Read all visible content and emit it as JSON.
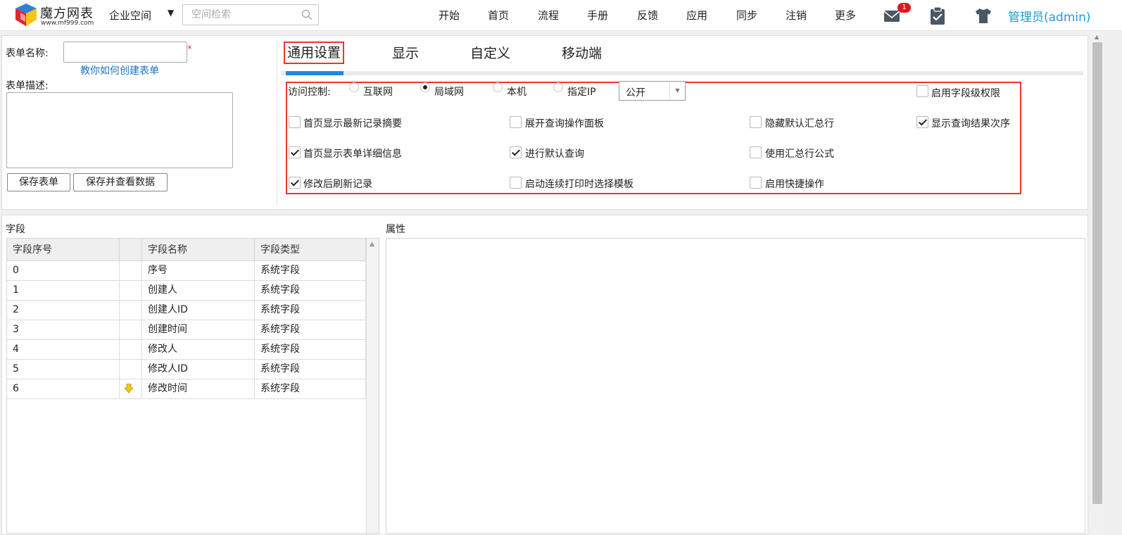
{
  "header": {
    "logo_title": "魔方网表",
    "logo_url": "www.mf999.com",
    "space_label": "企业空间",
    "search_placeholder": "空间检索",
    "nav": [
      "开始",
      "首页",
      "流程",
      "手册",
      "反馈",
      "应用",
      "同步",
      "注销",
      "更多"
    ],
    "mail_badge": "1",
    "admin": "管理员(admin)",
    "icons": [
      "mail-icon",
      "clipboard-icon",
      "tshirt-icon",
      "search-icon"
    ]
  },
  "form": {
    "name_label": "表单名称:",
    "name_value": "",
    "required_mark": "*",
    "help_link": "教你如何创建表单",
    "desc_label": "表单描述:",
    "desc_value": "",
    "save_button": "保存表单",
    "save_view_button": "保存并查看数据"
  },
  "tabs": [
    "通用设置",
    "显示",
    "自定义",
    "移动端"
  ],
  "active_tab": "通用设置",
  "settings": {
    "access_label": "访问控制:",
    "access_options": [
      "互联网",
      "局域网",
      "本机",
      "指定IP"
    ],
    "access_selected": "局域网",
    "visibility_select": "公开",
    "checkboxes": [
      {
        "label": "启用字段级权限",
        "checked": false
      },
      {
        "label": "首页显示最新记录摘要",
        "checked": false
      },
      {
        "label": "展开查询操作面板",
        "checked": false
      },
      {
        "label": "隐藏默认汇总行",
        "checked": false
      },
      {
        "label": "显示查询结果次序",
        "checked": true
      },
      {
        "label": "首页显示表单详细信息",
        "checked": true
      },
      {
        "label": "进行默认查询",
        "checked": true
      },
      {
        "label": "使用汇总行公式",
        "checked": false
      },
      {
        "label": "修改后刷新记录",
        "checked": true
      },
      {
        "label": "启动连续打印时选择模板",
        "checked": false
      },
      {
        "label": "启用快捷操作",
        "checked": false
      }
    ]
  },
  "fields": {
    "title": "字段",
    "columns": [
      "字段序号",
      "",
      "字段名称",
      "字段类型"
    ],
    "rows": [
      [
        "0",
        "序号",
        "系统字段"
      ],
      [
        "1",
        "创建人",
        "系统字段"
      ],
      [
        "2",
        "创建人ID",
        "系统字段"
      ],
      [
        "3",
        "创建时间",
        "系统字段"
      ],
      [
        "4",
        "修改人",
        "系统字段"
      ],
      [
        "5",
        "修改人ID",
        "系统字段"
      ],
      [
        "6",
        "修改时间",
        "系统字段"
      ]
    ]
  },
  "properties": {
    "title": "属性"
  },
  "colors": {
    "accent_blue": "#1e88e5",
    "link_blue": "#1e9bd7",
    "highlight_red": "#e33333",
    "badge_red": "#e8131a"
  }
}
